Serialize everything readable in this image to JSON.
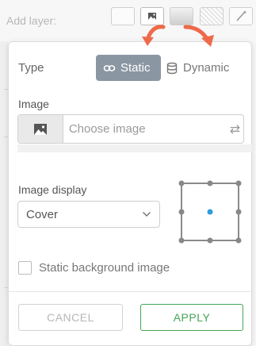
{
  "background": {
    "add_layer_label": "Add layer:",
    "layer_types": [
      "plain",
      "image",
      "gradient",
      "pattern",
      "magic"
    ]
  },
  "dialog": {
    "type_label": "Type",
    "options": {
      "static": "Static",
      "dynamic": "Dynamic"
    },
    "selected": "static",
    "image": {
      "label": "Image",
      "placeholder": "Choose image"
    },
    "image_display": {
      "label": "Image display",
      "value": "Cover"
    },
    "position": {
      "selected": "center"
    },
    "static_bg": {
      "label": "Static background image",
      "checked": false
    },
    "buttons": {
      "cancel": "CANCEL",
      "apply": "APPLY"
    }
  },
  "colors": {
    "accent_segment": "#8b96a3",
    "apply_green": "#44a558",
    "grid_dot": "#888888",
    "grid_selected": "#2e9ce0",
    "annotation_arrow": "#ee6a4a"
  }
}
